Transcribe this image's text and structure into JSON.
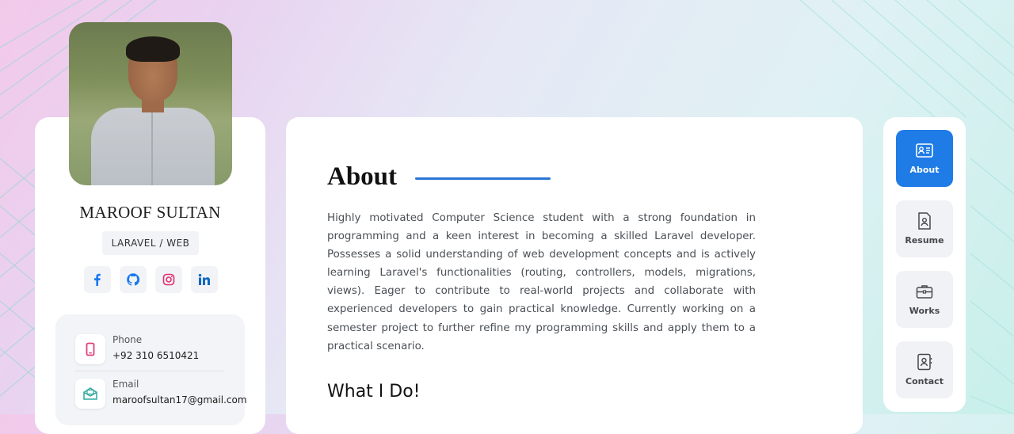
{
  "profile": {
    "name": "MAROOF SULTAN",
    "role": "LARAVEL / WEB",
    "socials": [
      {
        "icon": "facebook-icon",
        "color": "#1877f2"
      },
      {
        "icon": "github-icon",
        "color": "#1877f2"
      },
      {
        "icon": "instagram-icon",
        "color": "#e1306c"
      },
      {
        "icon": "linkedin-icon",
        "color": "#0a66c2"
      }
    ],
    "contacts": [
      {
        "label": "Phone",
        "value": "+92 310 6510421",
        "icon": "phone-icon",
        "color": "#e0407b"
      },
      {
        "label": "Email",
        "value": "maroofsultan17@gmail.com",
        "icon": "mail-icon",
        "color": "#2fa9a0"
      }
    ]
  },
  "main": {
    "about_title": "About",
    "about_text": "Highly motivated Computer Science student with a strong foundation in programming and a keen interest in becoming a skilled Laravel developer. Possesses a solid understanding of web development concepts and is actively learning Laravel's functionalities (routing, controllers, models, migrations, views). Eager to contribute to real-world projects and collaborate with experienced developers to gain practical knowledge. Currently working on a semester project to further refine my programming skills and apply them to a practical scenario.",
    "what_i_do_title": "What I Do!"
  },
  "nav": {
    "items": [
      {
        "label": "About",
        "icon": "id-card-icon",
        "active": true
      },
      {
        "label": "Resume",
        "icon": "resume-icon",
        "active": false
      },
      {
        "label": "Works",
        "icon": "briefcase-icon",
        "active": false
      },
      {
        "label": "Contact",
        "icon": "contact-book-icon",
        "active": false
      }
    ]
  },
  "colors": {
    "accent": "#1f7be6",
    "title_underline": "#2a75d4"
  }
}
